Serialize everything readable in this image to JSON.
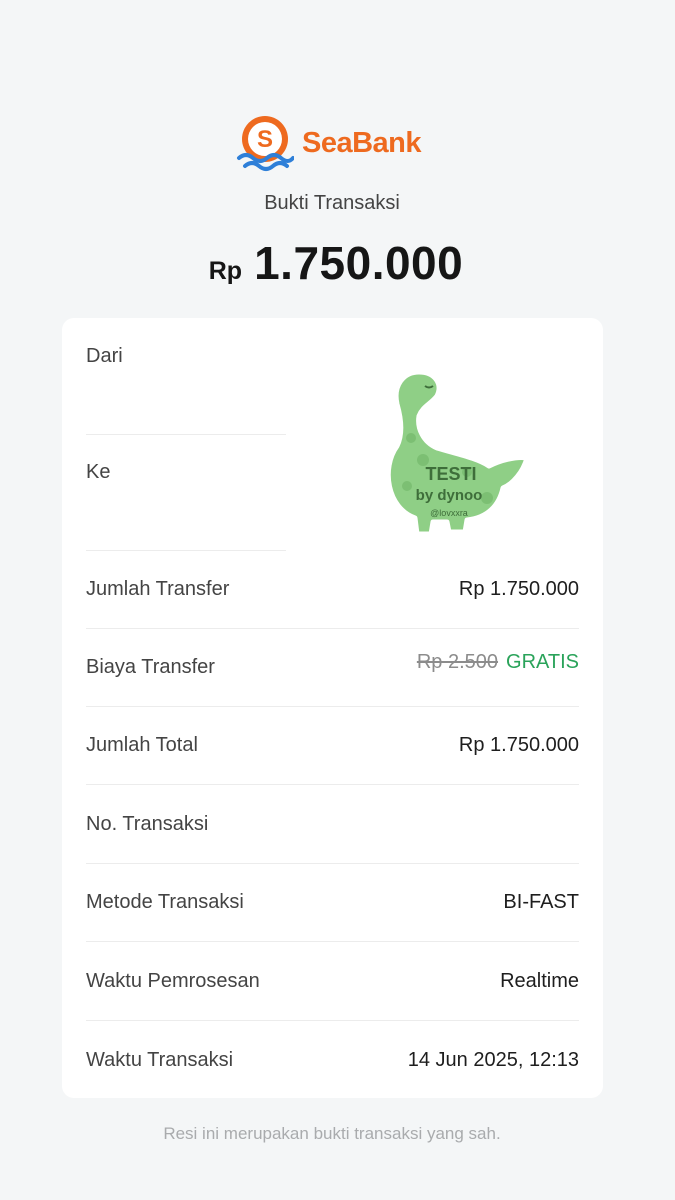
{
  "header": {
    "brand": "SeaBank",
    "subtitle": "Bukti Transaksi",
    "amount_currency": "Rp",
    "amount_value": "1.750.000"
  },
  "parties": {
    "from_label": "Dari",
    "to_label": "Ke"
  },
  "sticker": {
    "line1": "TESTI",
    "line2": "by dynoo",
    "handle": "@lovxxra"
  },
  "details": {
    "transfer_amount": {
      "label": "Jumlah Transfer",
      "value": "Rp 1.750.000"
    },
    "transfer_fee": {
      "label": "Biaya Transfer",
      "original": "Rp 2.500",
      "value": "GRATIS"
    },
    "total_amount": {
      "label": "Jumlah Total",
      "value": "Rp 1.750.000"
    },
    "transaction_no": {
      "label": "No. Transaksi",
      "value": ""
    },
    "method": {
      "label": "Metode Transaksi",
      "value": "BI-FAST"
    },
    "processing_time": {
      "label": "Waktu Pemrosesan",
      "value": "Realtime"
    },
    "transaction_time": {
      "label": "Waktu Transaksi",
      "value": "14 Jun 2025, 12:13"
    }
  },
  "footer": "Resi ini merupakan bukti transaksi yang sah.",
  "colors": {
    "brand_orange": "#ee6a1f",
    "wave_blue": "#2e7fd8",
    "free_green": "#2aa35a",
    "background": "#f4f6f7"
  },
  "icons": [
    "seabank-logo-icon",
    "dinosaur-sticker-icon"
  ]
}
